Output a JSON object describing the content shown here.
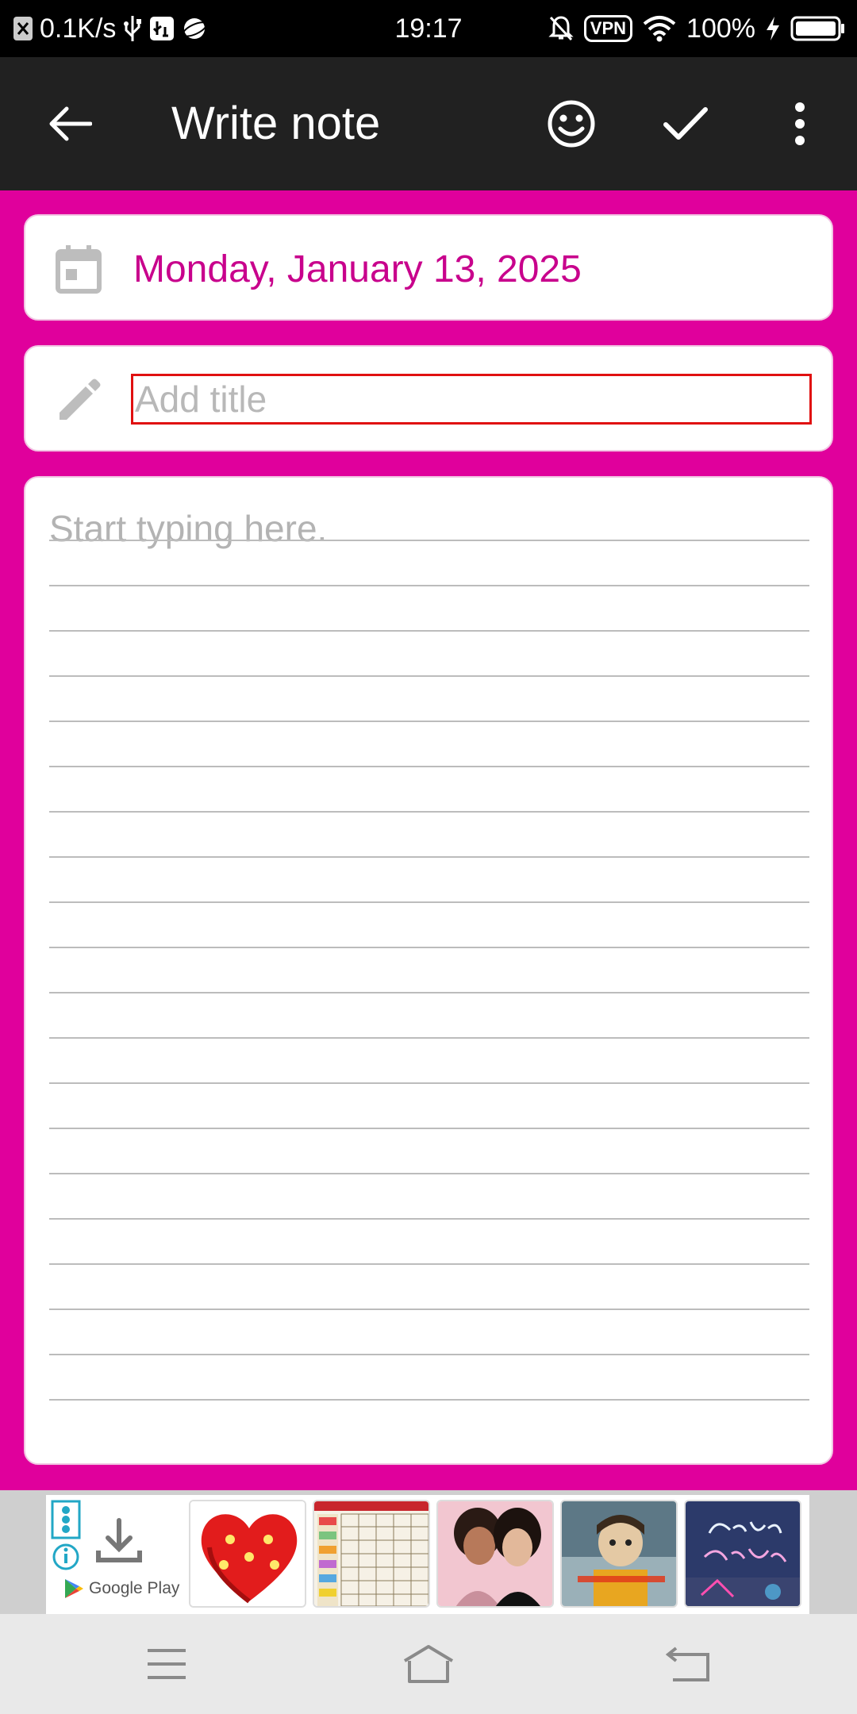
{
  "status_bar": {
    "speed": "0.1K/s",
    "time": "19:17",
    "vpn": "VPN",
    "battery": "100%"
  },
  "app_bar": {
    "title": "Write note",
    "icons": [
      "back-arrow-icon",
      "emoji-icon",
      "check-icon",
      "more-vert-icon"
    ]
  },
  "date_card": {
    "date": "Monday, January 13, 2025",
    "icon": "calendar-icon"
  },
  "title_card": {
    "placeholder": "Add title",
    "value": "",
    "icon": "pencil-icon"
  },
  "body": {
    "placeholder": "Start typing here."
  },
  "ad": {
    "store": "Google Play"
  },
  "colors": {
    "accent": "#e0009c",
    "date_text": "#c8008c",
    "app_bar": "#212121",
    "focus_border": "#e01010"
  }
}
